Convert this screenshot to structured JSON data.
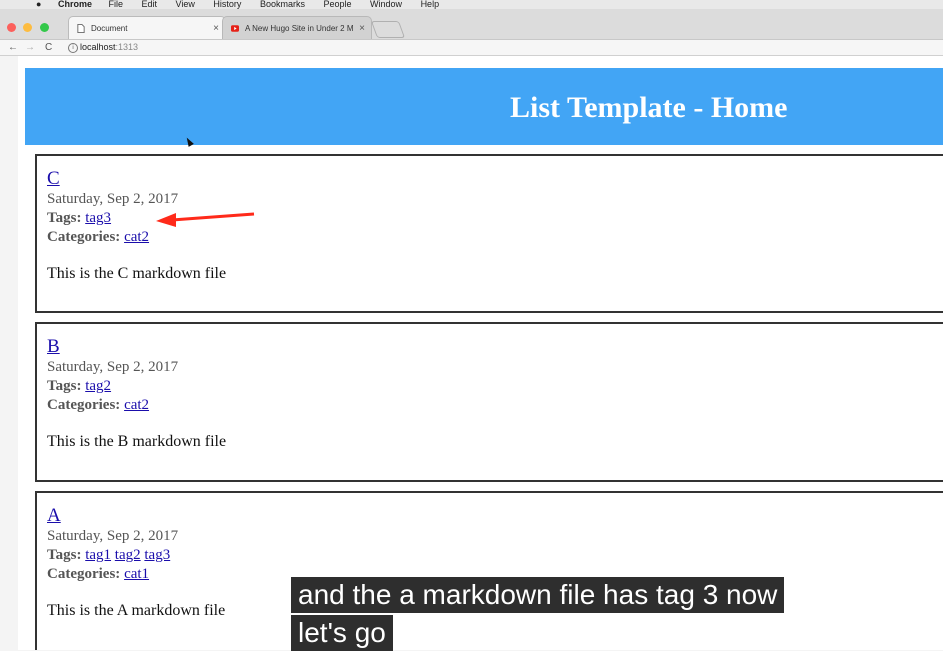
{
  "menubar": {
    "app": "Chrome",
    "items": [
      "File",
      "Edit",
      "View",
      "History",
      "Bookmarks",
      "People",
      "Window",
      "Help"
    ]
  },
  "tabs": [
    {
      "label": "Document",
      "active": true
    },
    {
      "label": "A New Hugo Site in Under 2 M",
      "active": false
    }
  ],
  "address": {
    "host": "localhost",
    "port": ":1313",
    "info": "i"
  },
  "nav": {
    "back": "←",
    "forward": "→",
    "reload": "C"
  },
  "page": {
    "header_title": "List Template - Home",
    "posts": [
      {
        "title": "C",
        "date": "Saturday, Sep 2, 2017",
        "tags_label": "Tags:",
        "tags": [
          "tag3"
        ],
        "categories_label": "Categories:",
        "categories": [
          "cat2"
        ],
        "body": "This is the C markdown file"
      },
      {
        "title": "B",
        "date": "Saturday, Sep 2, 2017",
        "tags_label": "Tags:",
        "tags": [
          "tag2"
        ],
        "categories_label": "Categories:",
        "categories": [
          "cat2"
        ],
        "body": "This is the B markdown file"
      },
      {
        "title": "A",
        "date": "Saturday, Sep 2, 2017",
        "tags_label": "Tags:",
        "tags": [
          "tag1",
          "tag2",
          "tag3"
        ],
        "categories_label": "Categories:",
        "categories": [
          "cat1"
        ],
        "body": "This is the A markdown file"
      }
    ]
  },
  "caption": {
    "line1": "and the a markdown file has tag 3 now",
    "line2": "let's go"
  },
  "colors": {
    "header": "#42a5f5",
    "annotation_arrow": "#ff2a1a",
    "link": "#1a0dab"
  }
}
